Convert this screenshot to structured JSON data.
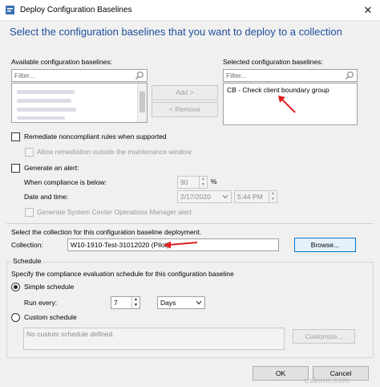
{
  "window": {
    "title": "Deploy Configuration Baselines",
    "close_glyph": "✕"
  },
  "heading": "Select the configuration baselines that you want to deploy to a collection",
  "available": {
    "label": "Available configuration baselines:",
    "filter_placeholder": "Filter..."
  },
  "selected": {
    "label": "Selected configuration baselines:",
    "filter_placeholder": "Filter...",
    "items": [
      "CB - Check client boundary group"
    ]
  },
  "buttons": {
    "add": "Add >",
    "remove": "< Remove",
    "browse": "Browse...",
    "customize": "Customize...",
    "ok": "OK",
    "cancel": "Cancel"
  },
  "remediate": {
    "label": "Remediate noncompliant rules when supported",
    "allow_outside": "Allow remediation outside the maintenance window"
  },
  "alert": {
    "label": "Generate an alert:",
    "compliance_label": "When compliance is below:",
    "compliance_value": "90",
    "percent": "%",
    "datetime_label": "Date and time:",
    "date_value": "2/17/2020",
    "time_value": "5:44 PM",
    "scom_label": "Generate System Center Operations Manager alert"
  },
  "collection": {
    "instruction": "Select the collection for this configuration baseline deployment.",
    "label": "Collection:",
    "value": "W10-1910-Test-31012020 (Pilot)"
  },
  "schedule": {
    "group_title": "Schedule",
    "instruction": "Specify the compliance evaluation schedule for this configuration baseline",
    "simple_label": "Simple schedule",
    "run_every_label": "Run every:",
    "run_every_value": "7",
    "unit_value": "Days",
    "custom_label": "Custom schedule",
    "custom_text": "No custom schedule defined."
  },
  "watermark": "eskonr.com",
  "colors": {
    "heading": "#1f4e9a",
    "arrow": "#e02020",
    "primary_border": "#0078d7"
  },
  "icons": {
    "search": "search-icon",
    "arrow": "red-arrow-icon"
  }
}
